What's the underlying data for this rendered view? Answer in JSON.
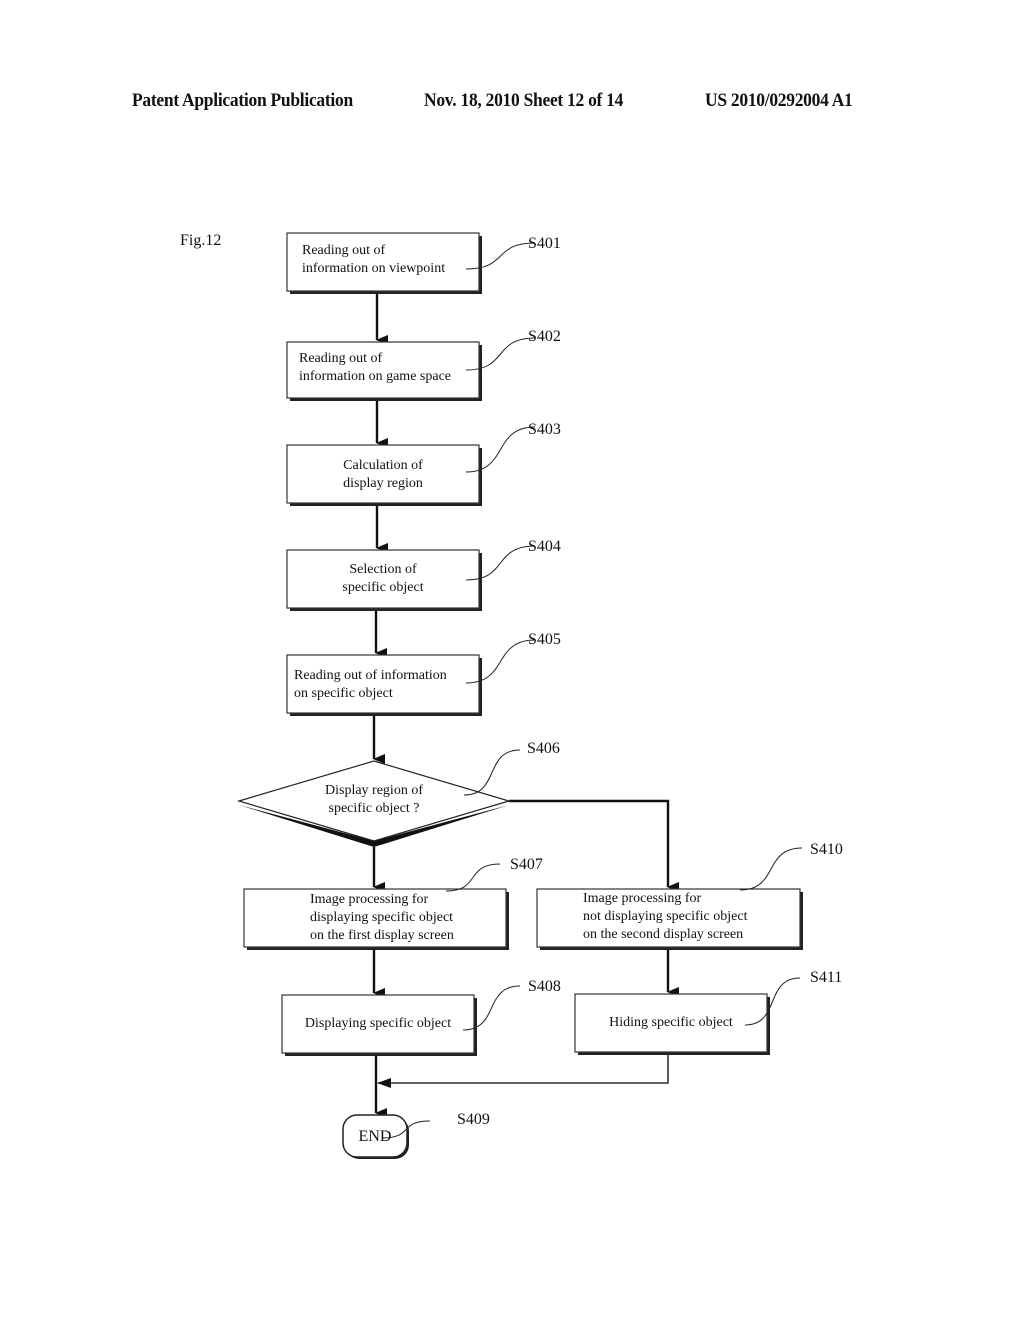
{
  "header": {
    "left": "Patent Application Publication",
    "middle": "Nov. 18, 2010   Sheet 12 of 14",
    "right": "US 2010/0292004 A1"
  },
  "figure": {
    "label": "Fig.12",
    "steps": [
      {
        "id": "S401",
        "type": "process",
        "lines": [
          "Reading out of",
          "information on viewpoint"
        ]
      },
      {
        "id": "S402",
        "type": "process",
        "lines": [
          "Reading out of",
          "information on game space"
        ]
      },
      {
        "id": "S403",
        "type": "process",
        "lines": [
          "Calculation of",
          "display region"
        ]
      },
      {
        "id": "S404",
        "type": "process",
        "lines": [
          "Selection of",
          "specific object"
        ]
      },
      {
        "id": "S405",
        "type": "process",
        "lines": [
          "Reading out of information",
          "on specific object"
        ]
      },
      {
        "id": "S406",
        "type": "decision",
        "lines": [
          "Display region of",
          "specific object ?"
        ]
      },
      {
        "id": "S407",
        "type": "process",
        "lines": [
          "Image processing for",
          "displaying specific object",
          "on the first display screen"
        ]
      },
      {
        "id": "S408",
        "type": "process",
        "lines": [
          "Displaying specific object"
        ]
      },
      {
        "id": "S409",
        "type": "terminal",
        "lines": [
          "END"
        ]
      },
      {
        "id": "S410",
        "type": "process",
        "lines": [
          "Image processing for",
          "not displaying specific object",
          "on the second display screen"
        ]
      },
      {
        "id": "S411",
        "type": "process",
        "lines": [
          "Hiding specific object"
        ]
      }
    ]
  }
}
